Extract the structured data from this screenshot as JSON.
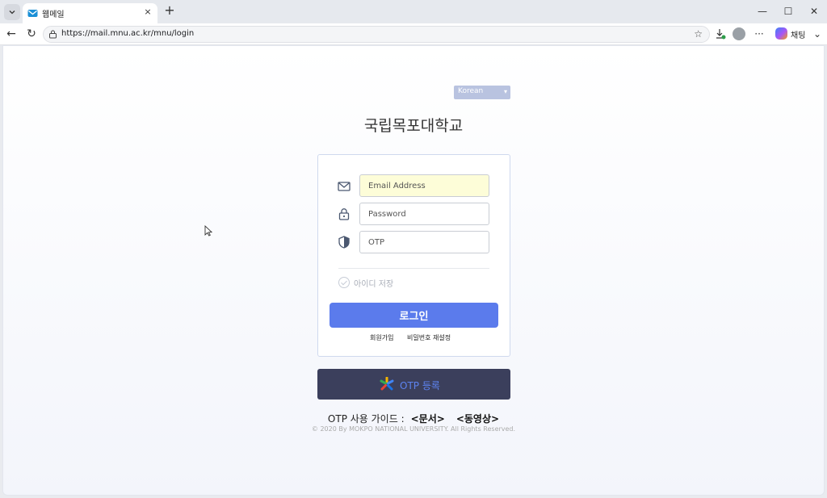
{
  "browser": {
    "tab_title": "웹메일",
    "tab_close": "×",
    "new_tab": "+",
    "url": "https://mail.mnu.ac.kr/mnu/login",
    "window_controls": {
      "minimize": "—",
      "maximize": "☐",
      "close": "✕"
    },
    "nav": {
      "back": "←",
      "reload": "↻"
    },
    "more": "···",
    "copilot_label": "채팅",
    "copilot_chevron": "⌄"
  },
  "page": {
    "language": {
      "selected": "Korean"
    },
    "university_title": "국립목포대학교",
    "login_form": {
      "email_placeholder": "Email Address",
      "password_placeholder": "Password",
      "otp_placeholder": "OTP",
      "remember_label": "아이디 저장",
      "login_button": "로그인",
      "signup_link": "회원가입",
      "reset_password_link": "비밀번호 재설정"
    },
    "otp_register_button": "OTP 등록",
    "otp_guide": {
      "label": "OTP 사용 가이드 :",
      "doc_link": "<문서>",
      "video_link": "<동영상>"
    },
    "copyright": "© 2020 By MOKPO NATIONAL UNIVERSITY. All Rights Reserved."
  },
  "colors": {
    "accent": "#5b7bec",
    "otp_button_bg": "#3b3f5c",
    "autofill_bg": "#fdfdd8",
    "lang_select_bg": "#b9c3e0"
  }
}
